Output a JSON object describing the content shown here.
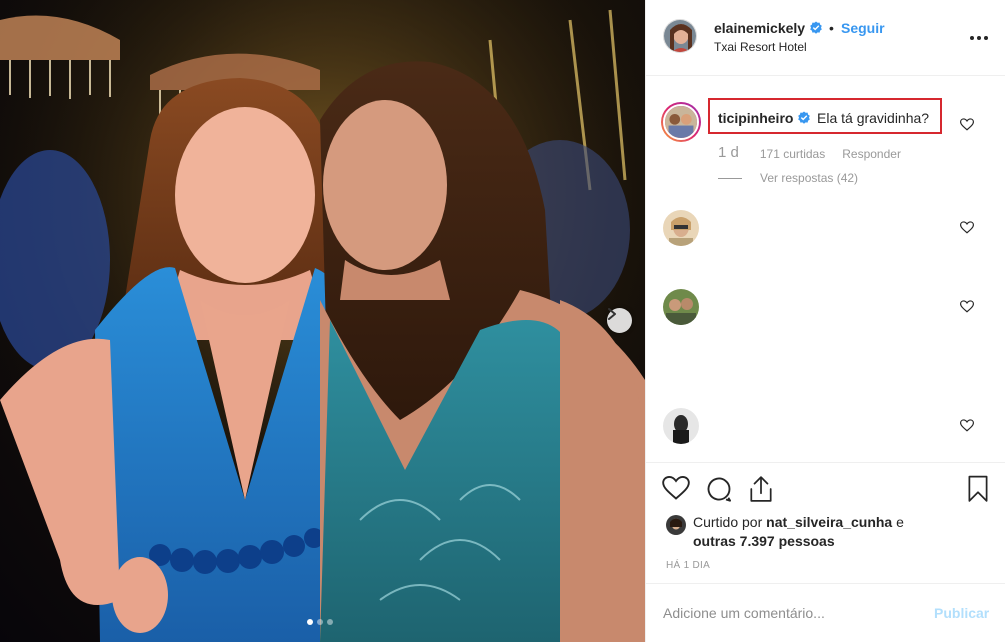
{
  "post": {
    "author": "elainemickely",
    "follow_label": "Seguir",
    "separator": "•",
    "location": "Txai Resort Hotel",
    "media_dots": 3,
    "active_media_index": 0
  },
  "highlighted_comment": {
    "username": "ticipinheiro",
    "text": "Ela tá gravidinha?",
    "age": "1 d",
    "likes": "171 curtidas",
    "reply_label": "Responder",
    "view_replies": "Ver respostas (42)"
  },
  "actions": {
    "liked_by_prefix": "Curtido por",
    "liked_by_user": "nat_silveira_cunha",
    "liked_by_connector": "e",
    "others": "outras 7.397 pessoas",
    "timestamp": "HÁ 1 DIA"
  },
  "add_comment": {
    "placeholder": "Adicione um comentário...",
    "publish_label": "Publicar"
  },
  "colors": {
    "link_blue": "#3897f0",
    "publish_disabled": "#b2dffc",
    "highlight_red": "#d6282f",
    "verified_blue": "#3897f0",
    "muted": "#999999"
  },
  "icons": {
    "verified": "verified-badge-icon",
    "more": "more-options-icon",
    "next": "chevron-right-icon",
    "like": "heart-icon",
    "comment": "comment-bubble-icon",
    "share": "share-icon",
    "save": "bookmark-icon"
  }
}
